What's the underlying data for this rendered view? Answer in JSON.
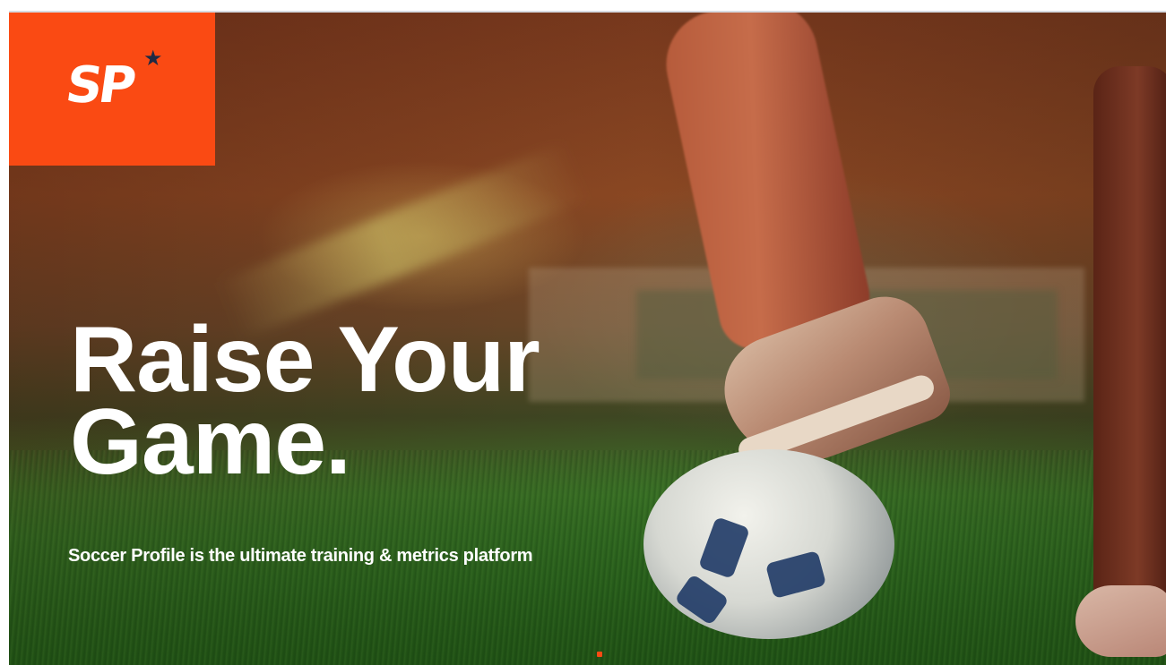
{
  "slide": {
    "logo": {
      "text": "SP",
      "star": "★",
      "brand_color": "#fa4a13",
      "star_color": "#1e2a44"
    },
    "headline": {
      "line1": "Raise Your",
      "line2": "Game."
    },
    "tagline": "Soccer Profile is the ultimate training & metrics platform",
    "colors": {
      "text": "#ffffff",
      "accent": "#fa4a13"
    }
  }
}
